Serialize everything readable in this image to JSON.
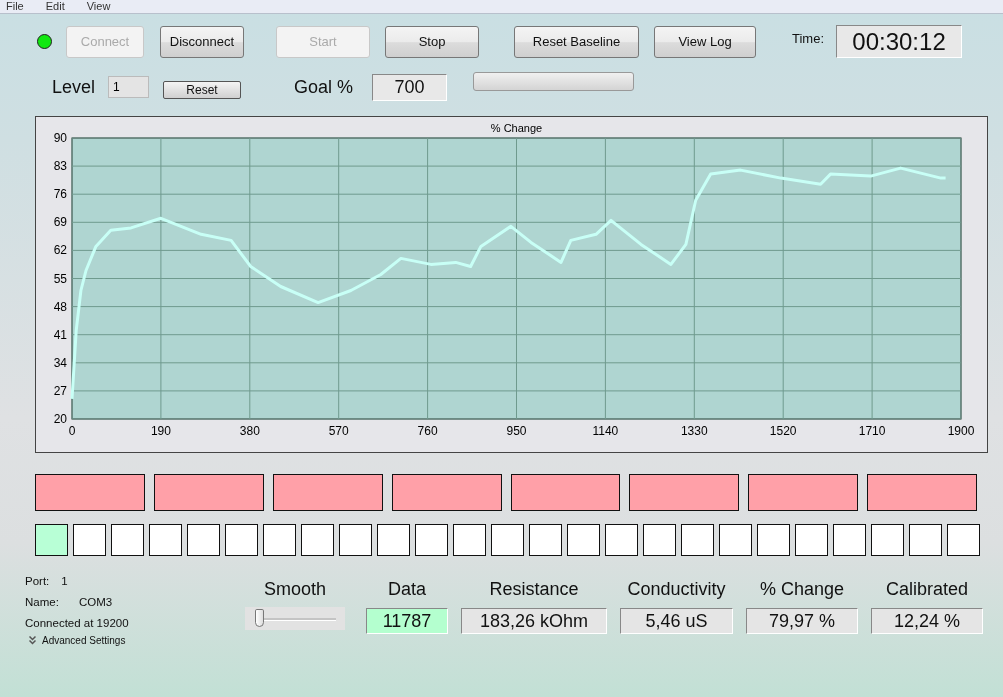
{
  "menu": [
    "File",
    "Edit",
    "View"
  ],
  "status_led": {
    "on": true
  },
  "buttons": [
    {
      "label": "Connect",
      "disabled": true
    },
    {
      "label": "Disconnect",
      "disabled": false
    },
    {
      "label": "Start",
      "disabled": true
    },
    {
      "label": "Stop",
      "disabled": false
    },
    {
      "label": "Reset Baseline",
      "disabled": false
    },
    {
      "label": "View Log",
      "disabled": false
    }
  ],
  "time": {
    "label": "Time:",
    "value": "00:30:12"
  },
  "level": {
    "label": "Level",
    "value": "1",
    "reset_button": "Reset"
  },
  "goal": {
    "label": "Goal %",
    "value": "700"
  },
  "progress": {
    "level": 0
  },
  "chart": {
    "chart_data": {
      "type": "line",
      "title": "% Change",
      "x": [
        0,
        9,
        19,
        30,
        51,
        83,
        126,
        190,
        276,
        340,
        382,
        446,
        526,
        596,
        660,
        703,
        767,
        820,
        852,
        874,
        938,
        981,
        1045,
        1066,
        1120,
        1152,
        1216,
        1280,
        1312,
        1333,
        1365,
        1429,
        1515,
        1600,
        1621,
        1707,
        1771,
        1857,
        1867
      ],
      "series": [
        {
          "color": "#c8fff6",
          "values": [
            25,
            42,
            52,
            57,
            63,
            67,
            67.6,
            70,
            66,
            64.5,
            58,
            53,
            49,
            52,
            56,
            60,
            58.5,
            59,
            58,
            63,
            68,
            64,
            59,
            64.5,
            66,
            69.5,
            63.5,
            58.5,
            63.5,
            74.5,
            81,
            82,
            80,
            78.5,
            81,
            80.5,
            82.5,
            80,
            80
          ]
        }
      ],
      "xlim": [
        0,
        1900
      ],
      "ylim": [
        20,
        90
      ],
      "xticks": [
        0,
        190,
        380,
        570,
        760,
        950,
        1140,
        1330,
        1520,
        1710,
        1900
      ],
      "yticks": [
        20,
        27,
        34,
        41,
        48,
        55,
        62,
        69,
        76,
        83,
        90
      ],
      "grid": true
    }
  },
  "zone_blocks": [
    {
      "on": false
    },
    {
      "on": false
    },
    {
      "on": false
    },
    {
      "on": false
    },
    {
      "on": false
    },
    {
      "on": false
    },
    {
      "on": false
    },
    {
      "on": false
    }
  ],
  "step_squares": [
    {
      "on": true
    },
    {
      "on": false
    },
    {
      "on": false
    },
    {
      "on": false
    },
    {
      "on": false
    },
    {
      "on": false
    },
    {
      "on": false
    },
    {
      "on": false
    },
    {
      "on": false
    },
    {
      "on": false
    },
    {
      "on": false
    },
    {
      "on": false
    },
    {
      "on": false
    },
    {
      "on": false
    },
    {
      "on": false
    },
    {
      "on": false
    },
    {
      "on": false
    },
    {
      "on": false
    },
    {
      "on": false
    },
    {
      "on": false
    },
    {
      "on": false
    },
    {
      "on": false
    },
    {
      "on": false
    },
    {
      "on": false
    },
    {
      "on": false
    }
  ],
  "connection": {
    "port_label": "Port:",
    "port": "1",
    "name_label": "Name:",
    "name": "COM3",
    "status": "Connected at 19200",
    "advanced": "Advanced Settings"
  },
  "smooth": {
    "label": "Smooth",
    "level": 0.05
  },
  "readouts": [
    {
      "label": "Data",
      "value": "11787",
      "highlighted": true
    },
    {
      "label": "Resistance",
      "value": "183,26 kOhm",
      "highlighted": false
    },
    {
      "label": "Conductivity",
      "value": "5,46 uS",
      "highlighted": false
    },
    {
      "label": "% Change",
      "value": "79,97 %",
      "highlighted": false
    },
    {
      "label": "Calibrated",
      "value": "12,24 %",
      "highlighted": false
    }
  ]
}
